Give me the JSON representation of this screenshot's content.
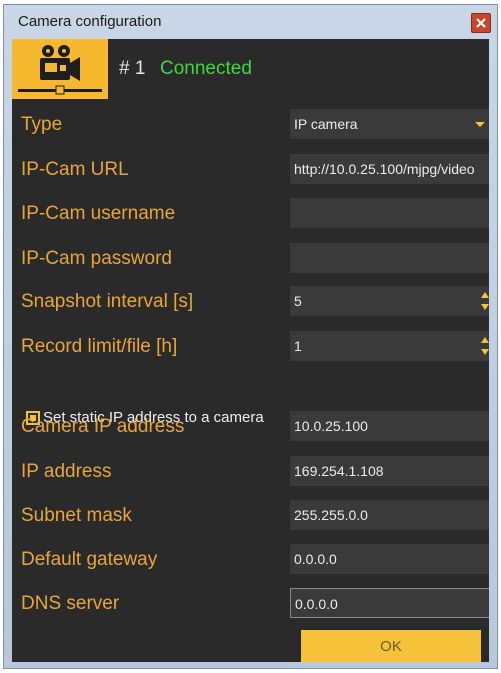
{
  "window": {
    "title": "Camera configuration"
  },
  "header": {
    "camera_number": "# 1",
    "status": "Connected"
  },
  "fields": [
    {
      "label": "Type",
      "value": "IP camera",
      "control": "dropdown"
    },
    {
      "label": "IP-Cam URL",
      "value": "http://10.0.25.100/mjpg/video",
      "control": "text"
    },
    {
      "label": "IP-Cam username",
      "value": "",
      "control": "text"
    },
    {
      "label": "IP-Cam password",
      "value": "",
      "control": "password"
    },
    {
      "label": "Snapshot interval [s]",
      "value": "5",
      "control": "spinner"
    },
    {
      "label": "Record limit/file [h]",
      "value": "1",
      "control": "spinner"
    }
  ],
  "static_ip": {
    "label": "Set static IP address to a camera",
    "checked": true
  },
  "network_fields": [
    {
      "label": "Camera IP address",
      "value": "10.0.25.100"
    },
    {
      "label": "IP address",
      "value": "169.254.1.108"
    },
    {
      "label": "Subnet mask",
      "value": "255.255.0.0"
    },
    {
      "label": "Default gateway",
      "value": "0.0.0.0"
    },
    {
      "label": "DNS server",
      "value": "0.0.0.0"
    }
  ],
  "ok_button": {
    "label": "OK"
  },
  "colors": {
    "accent": "#f5b82e",
    "label": "#e8a63a",
    "status": "#3ed83e",
    "button_bg": "#f5c23a",
    "field_bg": "#3a3a3a",
    "panel_bg": "#2a2a2a"
  },
  "icons": {
    "logo": "film-camera-icon",
    "close": "close-icon",
    "dropdown": "chevron-down-icon",
    "spinner": "spinner-arrows-icon"
  }
}
